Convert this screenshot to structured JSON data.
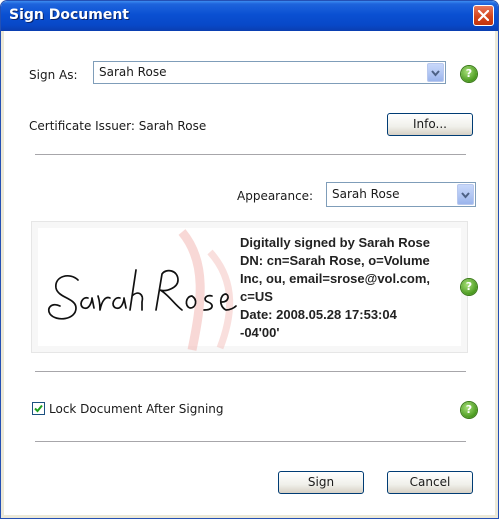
{
  "window": {
    "title": "Sign Document"
  },
  "sign_as": {
    "label": "Sign As:",
    "value": "Sarah Rose"
  },
  "certificate": {
    "label": "Certificate Issuer: Sarah Rose",
    "info_button": "Info..."
  },
  "appearance": {
    "label": "Appearance:",
    "value": "Sarah Rose"
  },
  "signature_preview": {
    "handwritten_name": "Sarah Rose",
    "lines": [
      "Digitally signed by Sarah Rose",
      "DN: cn=Sarah Rose, o=Volume",
      "Inc, ou, email=srose@vol.com,",
      "c=US",
      "Date: 2008.05.28 17:53:04",
      "-04'00'"
    ]
  },
  "lock": {
    "label": "Lock Document After Signing",
    "checked": true
  },
  "buttons": {
    "sign": "Sign",
    "cancel": "Cancel"
  },
  "help_icon_text": "?",
  "colors": {
    "titlebar": "#0a50d2",
    "close": "#d4451c",
    "help": "#4a9a1e",
    "watermark": "#f2b8b4"
  }
}
